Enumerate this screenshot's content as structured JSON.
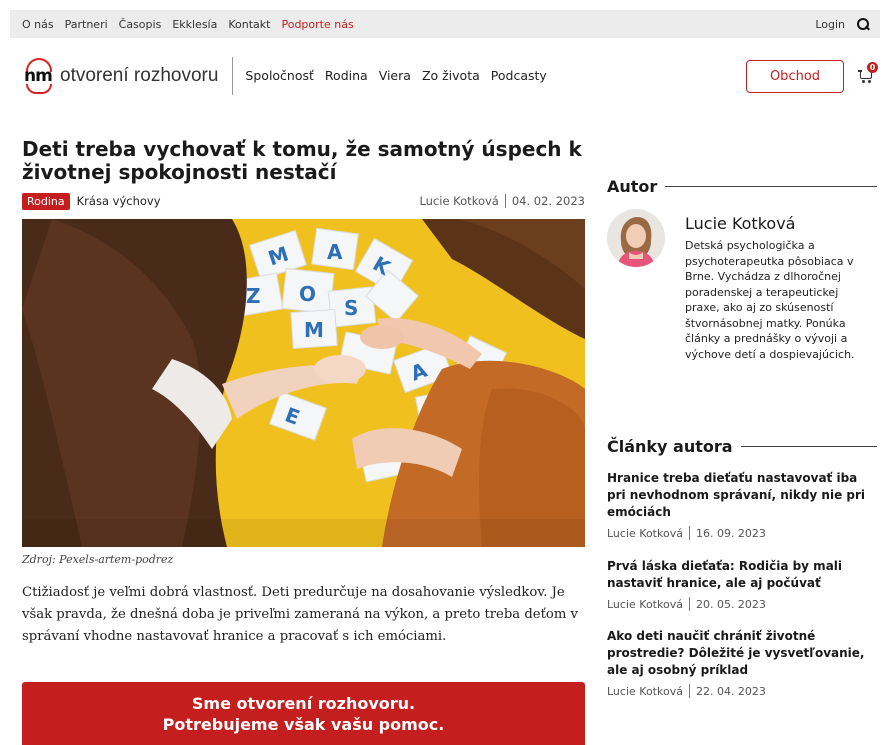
{
  "topbar": {
    "links": [
      "O nás",
      "Partneri",
      "Časopis",
      "Ekklesía",
      "Kontakt"
    ],
    "support_link": "Podporte nás",
    "login": "Login",
    "search_icon": "search-icon"
  },
  "header": {
    "logo_mark": "nm",
    "logo_text": "otvorení rozhovoru",
    "nav": [
      "Spoločnosť",
      "Rodina",
      "Viera",
      "Zo života",
      "Podcasty"
    ],
    "shop_label": "Obchod",
    "cart_count": "0",
    "accent_color": "#c41e1e"
  },
  "article": {
    "title": "Deti treba vychovať k tomu, že samotný úspech k životnej spokojnosti nestačí",
    "badge": "Rodina",
    "category": "Krása výchovy",
    "author": "Lucie Kotková",
    "date": "04. 02. 2023",
    "image_caption": "Zdroj: Pexels-artem-podrez",
    "lead": "Ctižiadosť je veľmi dobrá vlastnosť. Deti predurčuje na dosahovanie výsledkov. Je však pravda, že dnešná doba je priveľmi zameraná na výkon, a preto treba deťom v správaní vhodne nastavovať hranice a pracovať s ich emóciami.",
    "support_line1": "Sme otvorení rozhovoru.",
    "support_line2": "Potrebujeme však vašu pomoc."
  },
  "sidebar": {
    "author_heading": "Autor",
    "author_name": "Lucie Kotková",
    "author_bio": "Detská psychologička a psychoterapeutka pôsobiaca v Brne. Vychádza z dlhoročnej poradenskej a terapeutickej praxe, ako aj zo skúseností štvornásobnej matky. Ponúka články a prednášky o vývoji a výchove detí a dospievajúcich.",
    "articles_heading": "Články autora",
    "articles": [
      {
        "title": "Hranice treba dieťaťu nastavovať iba pri nevhodnom správaní, nikdy nie pri emóciách",
        "author": "Lucie Kotková",
        "date": "16. 09. 2023"
      },
      {
        "title": "Prvá láska dieťaťa: Rodičia by mali nastaviť hranice, ale aj počúvať",
        "author": "Lucie Kotková",
        "date": "20. 05. 2023"
      },
      {
        "title": "Ako deti naučiť chrániť životné prostredie? Dôležité je vysvetľovanie, ale aj osobný príklad",
        "author": "Lucie Kotková",
        "date": "22. 04. 2023"
      }
    ]
  }
}
